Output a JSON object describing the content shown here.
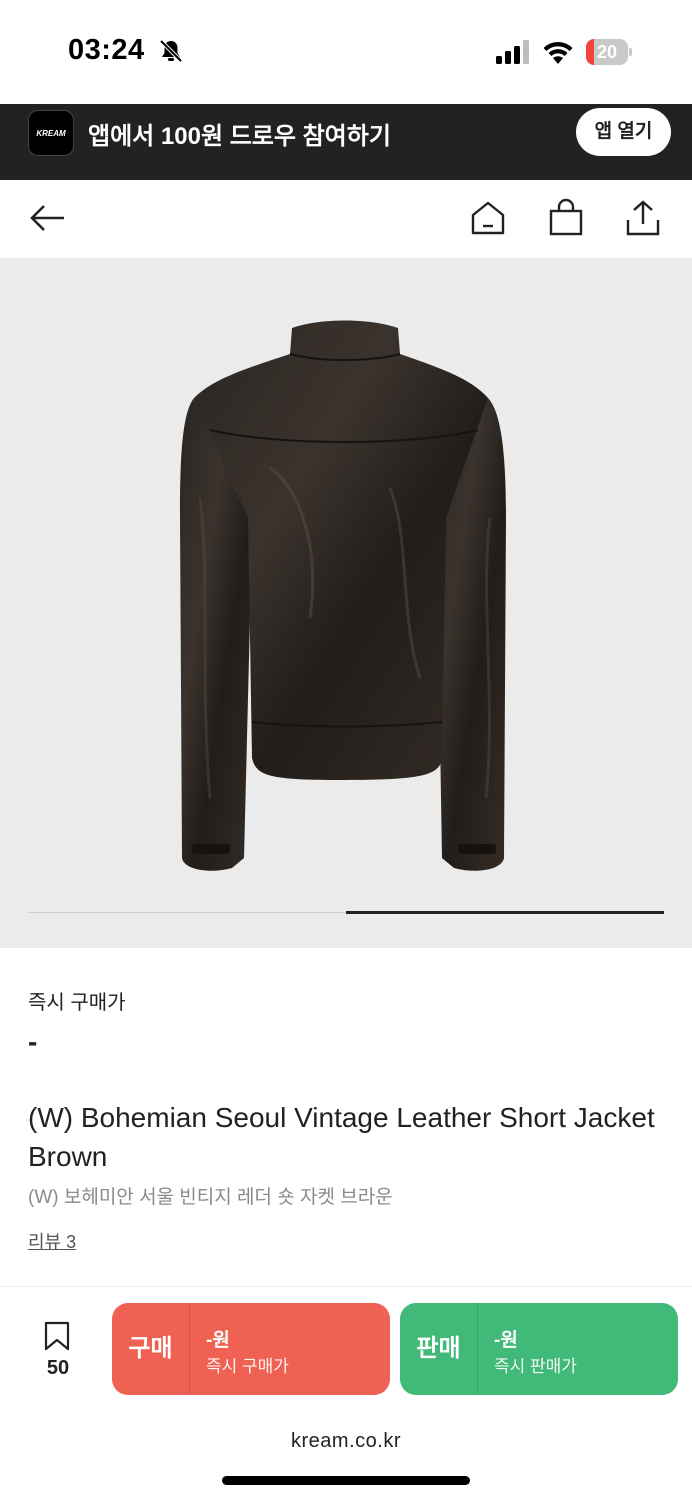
{
  "status_bar": {
    "time": "03:24",
    "battery": "20",
    "battery_level": 0.2,
    "icons": [
      "bell-off-icon",
      "cellular-signal-icon",
      "wifi-icon",
      "battery-icon"
    ]
  },
  "app_banner": {
    "logo_text": "KREAM",
    "text": "앱에서 100원 드로우 참여하기",
    "button_label": "앱 열기"
  },
  "nav": {
    "icons": [
      "back-arrow-icon",
      "home-icon",
      "shopping-bag-icon",
      "share-icon"
    ]
  },
  "product_image": {
    "slide_index": 2,
    "slide_count": 2
  },
  "product": {
    "price_label": "즉시 구매가",
    "price_value": "-",
    "name": "(W) Bohemian Seoul Vintage Leather Short Jacket Brown",
    "name_ko": "(W) 보헤미안 서울 빈티지 레더 숏 자켓 브라운",
    "review_link": "리뷰 3"
  },
  "action_bar": {
    "bookmark_count": "50",
    "buy": {
      "label": "구매",
      "price": "-원",
      "sub": "즉시 구매가",
      "color": "#ef6253"
    },
    "sell": {
      "label": "판매",
      "price": "-원",
      "sub": "즉시 판매가",
      "color": "#41b979"
    }
  },
  "browser": {
    "url": "kream.co.kr"
  }
}
